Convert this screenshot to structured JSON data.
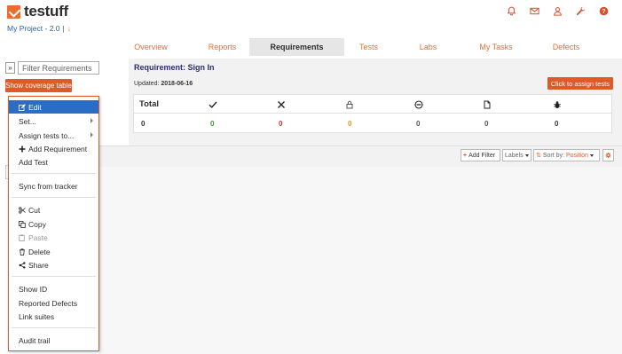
{
  "header": {
    "logo_text": "testuff",
    "project": "My Project - 2.0",
    "project_sep": "|",
    "project_arrow": "↓"
  },
  "top_icons": [
    "bell-icon",
    "mail-icon",
    "user-icon",
    "wrench-icon",
    "help-icon"
  ],
  "nav": {
    "tabs": [
      {
        "label": "Overview",
        "active": false
      },
      {
        "label": "Reports",
        "active": false
      },
      {
        "label": "Requirements",
        "active": true
      },
      {
        "label": "Tests",
        "active": false
      },
      {
        "label": "Labs",
        "active": false
      },
      {
        "label": "My Tasks",
        "active": false
      },
      {
        "label": "Defects",
        "active": false
      }
    ]
  },
  "left": {
    "expand_label": "»",
    "filter_placeholder": "Filter Requirements",
    "coverage_button": "Show coverage table"
  },
  "requirement": {
    "title": "Requirement: Sign In",
    "updated_label": "Updated:",
    "updated_date": "2018-06-16",
    "assign_button": "Click to assign tests"
  },
  "coverage": {
    "total_label": "Total",
    "icons": [
      "check-icon",
      "cross-icon",
      "lock-icon",
      "minus-circle-icon",
      "document-icon",
      "bug-icon"
    ],
    "values": [
      "0",
      "0",
      "0",
      "0",
      "0",
      "0",
      "0"
    ],
    "value_colors": [
      "#2d2d2d",
      "#3a9a2f",
      "#d9302a",
      "#e89a1a",
      "#555555",
      "#555555",
      "#2d2d2d"
    ]
  },
  "filter_bar": {
    "add_filter": "Add Filter",
    "labels": "Labels",
    "sort_prefix": "Sort by:",
    "sort_value": "Position"
  },
  "context_menu": {
    "items": [
      {
        "label": "Edit",
        "icon": "edit-icon"
      },
      {
        "label": "Set...",
        "submenu": true
      },
      {
        "label": "Assign tests to...",
        "submenu": true
      },
      {
        "label": "Add Requirement",
        "icon": "plus-icon"
      },
      {
        "label": "Add Test"
      },
      {
        "label": "Sync from tracker"
      },
      {
        "label": "Cut",
        "icon": "scissors-icon"
      },
      {
        "label": "Copy",
        "icon": "copy-icon"
      },
      {
        "label": "Paste",
        "icon": "paste-icon",
        "disabled": true
      },
      {
        "label": "Delete",
        "icon": "trash-icon"
      },
      {
        "label": "Share",
        "icon": "share-icon"
      },
      {
        "label": "Show ID"
      },
      {
        "label": "Reported Defects"
      },
      {
        "label": "Link suites"
      },
      {
        "label": "Audit trail"
      }
    ]
  },
  "colors": {
    "accent": "#e05a28",
    "brand_link": "#2b5ca8",
    "menu_highlight": "#2b6cc4"
  }
}
